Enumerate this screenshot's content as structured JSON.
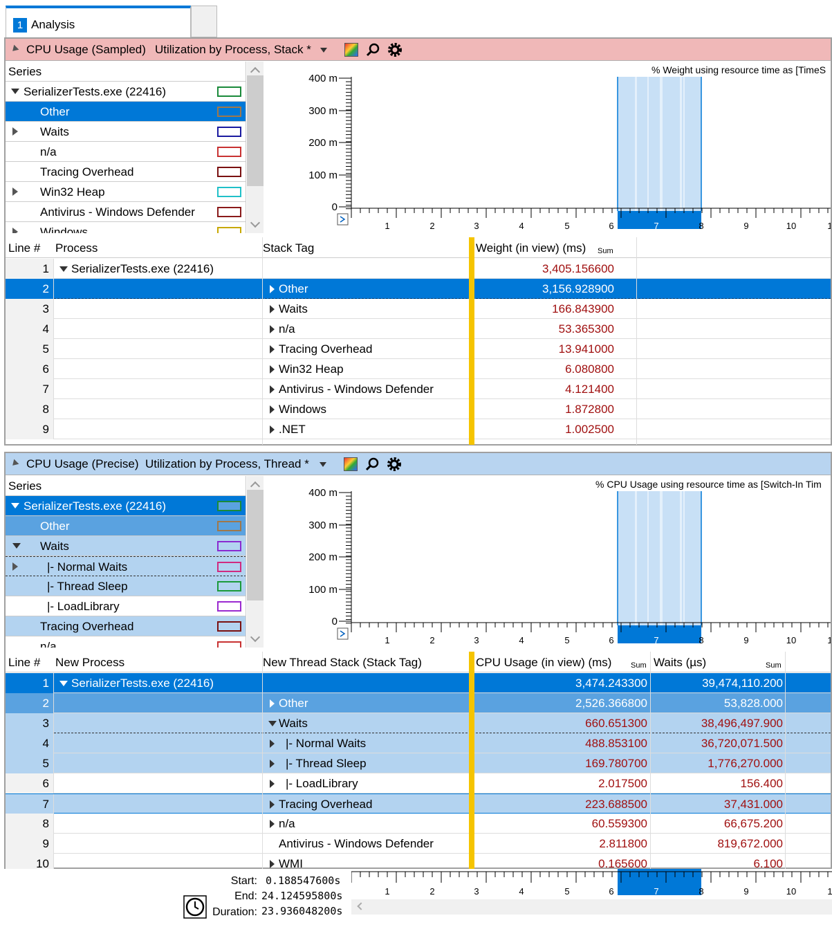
{
  "tab": {
    "number": "1",
    "label": "Analysis"
  },
  "panel1": {
    "title": "CPU Usage (Sampled)",
    "preset": "Utilization by Process, Stack *",
    "series_header": "Series",
    "series": [
      {
        "label": "SerializerTests.exe (22416)",
        "color": "#1a8a3a"
      },
      {
        "label": "Other",
        "color": "#a0784a"
      },
      {
        "label": "Waits",
        "color": "#1a1aa0"
      },
      {
        "label": "n/a",
        "color": "#c83232"
      },
      {
        "label": "Tracing Overhead",
        "color": "#7a1010"
      },
      {
        "label": "Win32 Heap",
        "color": "#20c0c8"
      },
      {
        "label": "Antivirus - Windows Defender",
        "color": "#8a1a1a"
      },
      {
        "label": "Windows",
        "color": "#c8a800"
      }
    ],
    "chart_title": "% Weight using resource time as [TimeS",
    "columns": {
      "line": "Line #",
      "process": "Process",
      "stack": "Stack Tag",
      "weight": "Weight (in view) (ms)",
      "sum": "Sum"
    },
    "rows": [
      {
        "line": "1",
        "process": "SerializerTests.exe (22416)",
        "stack": "",
        "weight": "3,405.156600"
      },
      {
        "line": "2",
        "process": "",
        "stack": "Other",
        "weight": "3,156.928900"
      },
      {
        "line": "3",
        "process": "",
        "stack": "Waits",
        "weight": "166.843900"
      },
      {
        "line": "4",
        "process": "",
        "stack": "n/a",
        "weight": "53.365300"
      },
      {
        "line": "5",
        "process": "",
        "stack": "Tracing Overhead",
        "weight": "13.941000"
      },
      {
        "line": "6",
        "process": "",
        "stack": "Win32 Heap",
        "weight": "6.080800"
      },
      {
        "line": "7",
        "process": "",
        "stack": "Antivirus - Windows Defender",
        "weight": "4.121400"
      },
      {
        "line": "8",
        "process": "",
        "stack": "Windows",
        "weight": "1.872800"
      },
      {
        "line": "9",
        "process": "",
        "stack": ".NET",
        "weight": "1.002500"
      }
    ]
  },
  "panel2": {
    "title": "CPU Usage (Precise)",
    "preset": "Utilization by Process, Thread *",
    "series_header": "Series",
    "series": [
      {
        "label": "SerializerTests.exe (22416)",
        "color": "#1a8a3a"
      },
      {
        "label": "Other",
        "color": "#a0784a"
      },
      {
        "label": "Waits",
        "color": "#8a2ad0"
      },
      {
        "label": "|- Normal Waits",
        "color": "#d02a80"
      },
      {
        "label": "|- Thread Sleep",
        "color": "#1a9a3a"
      },
      {
        "label": "|- LoadLibrary",
        "color": "#9a2ad0"
      },
      {
        "label": "Tracing Overhead",
        "color": "#7a1010"
      },
      {
        "label": "n/a",
        "color": "#c83232"
      }
    ],
    "chart_title": "% CPU Usage using resource time as [Switch-In Tim",
    "columns": {
      "line": "Line #",
      "process": "New Process",
      "stack": "New Thread Stack (Stack Tag)",
      "cpu": "CPU Usage (in view) (ms)",
      "waits": "Waits (µs)",
      "sum": "Sum"
    },
    "rows": [
      {
        "line": "1",
        "process": "SerializerTests.exe (22416)",
        "stack": "",
        "cpu": "3,474.243300",
        "waits": "39,474,110.200"
      },
      {
        "line": "2",
        "process": "",
        "stack": "Other",
        "cpu": "2,526.366800",
        "waits": "53,828.000"
      },
      {
        "line": "3",
        "process": "",
        "stack": "Waits",
        "cpu": "660.651300",
        "waits": "38,496,497.900"
      },
      {
        "line": "4",
        "process": "",
        "stack": "|- Normal Waits",
        "cpu": "488.853100",
        "waits": "36,720,071.500"
      },
      {
        "line": "5",
        "process": "",
        "stack": "|- Thread Sleep",
        "cpu": "169.780700",
        "waits": "1,776,270.000"
      },
      {
        "line": "6",
        "process": "",
        "stack": "|- LoadLibrary",
        "cpu": "2.017500",
        "waits": "156.400"
      },
      {
        "line": "7",
        "process": "",
        "stack": "Tracing Overhead",
        "cpu": "223.688500",
        "waits": "37,431.000"
      },
      {
        "line": "8",
        "process": "",
        "stack": "n/a",
        "cpu": "60.559300",
        "waits": "66,675.200"
      },
      {
        "line": "9",
        "process": "",
        "stack": "Antivirus - Windows Defender",
        "cpu": "2.811800",
        "waits": "819,672.000"
      },
      {
        "line": "10",
        "process": "",
        "stack": "WMI",
        "cpu": "0.165600",
        "waits": "6.100"
      }
    ]
  },
  "axis": {
    "y_ticks": [
      "400 m",
      "300 m",
      "200 m",
      "100 m",
      "0"
    ],
    "x_ticks": [
      "1",
      "2",
      "3",
      "4",
      "5",
      "6",
      "7",
      "8",
      "9",
      "10",
      "1"
    ]
  },
  "footer": {
    "start_label": "Start:",
    "start": "0.188547600s",
    "end_label": "End:",
    "end": "24.124595800s",
    "duration_label": "Duration:",
    "duration": "23.936048200s"
  },
  "colors": {
    "selection": "#0078d7",
    "panel1_header": "#f0b8b8",
    "panel2_header": "#b8d4f0",
    "divider": "#f5c400",
    "value_text": "#a01010"
  }
}
